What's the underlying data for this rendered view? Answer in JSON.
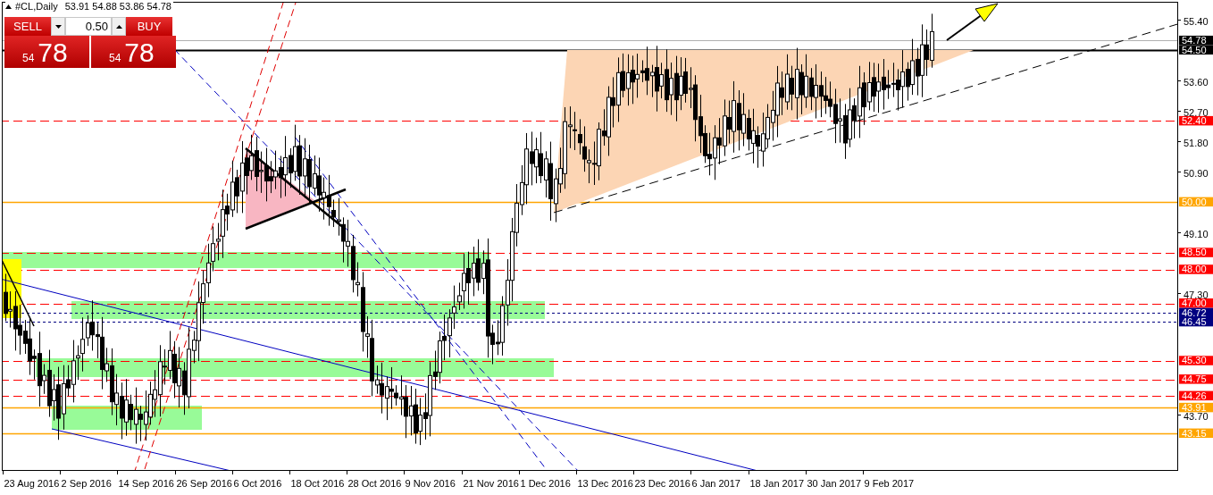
{
  "symbol_bar": {
    "symbol": "#CL,Daily",
    "ohlc": "53.91 54.88 53.86 54.78"
  },
  "trade_panel": {
    "sell_label": "SELL",
    "lot": "0.50",
    "buy_label": "BUY",
    "sell_price": {
      "big_figure": "54",
      "pips": "78"
    },
    "buy_price": {
      "big_figure": "54",
      "pips": "78"
    }
  },
  "price_axis": {
    "ticks": [
      "55.40",
      "53.60",
      "52.70",
      "51.80",
      "50.90",
      "49.10",
      "47.30",
      "43.70"
    ]
  },
  "price_tags": [
    {
      "text": "54.78",
      "color": "#000000",
      "kind": "bid"
    },
    {
      "text": "54.50",
      "color": "#000000",
      "kind": "solid"
    },
    {
      "text": "52.40",
      "color": "#ff0000",
      "kind": "dashed"
    },
    {
      "text": "50.00",
      "color": "#ffa500",
      "kind": "solid"
    },
    {
      "text": "48.50",
      "color": "#ff0000",
      "kind": "dashed"
    },
    {
      "text": "48.00",
      "color": "#ff0000",
      "kind": "dashed"
    },
    {
      "text": "47.00",
      "color": "#ff0000",
      "kind": "dashed"
    },
    {
      "text": "46.72",
      "color": "#000080",
      "kind": "dotted"
    },
    {
      "text": "46.45",
      "color": "#000080",
      "kind": "dotted"
    },
    {
      "text": "45.30",
      "color": "#ff0000",
      "kind": "dashed"
    },
    {
      "text": "44.75",
      "color": "#ff0000",
      "kind": "dashed"
    },
    {
      "text": "44.26",
      "color": "#ff0000",
      "kind": "dashed"
    },
    {
      "text": "43.91",
      "color": "#ffa500",
      "kind": "solid"
    },
    {
      "text": "43.15",
      "color": "#ffa500",
      "kind": "solid"
    }
  ],
  "time_axis": {
    "labels": [
      "23 Aug 2016",
      "2 Sep 2016",
      "14 Sep 2016",
      "26 Sep 2016",
      "6 Oct 2016",
      "18 Oct 2016",
      "28 Oct 2016",
      "9 Nov 2016",
      "21 Nov 2016",
      "1 Dec 2016",
      "13 Dec 2016",
      "23 Dec 2016",
      "6 Jan 2017",
      "18 Jan 2017",
      "30 Jan 2017",
      "9 Feb 2017"
    ]
  }
}
